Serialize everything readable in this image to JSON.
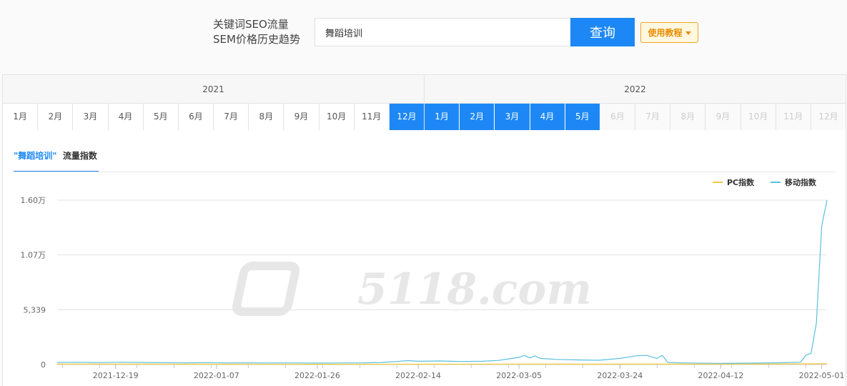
{
  "search": {
    "label_line1": "关键词SEO流量",
    "label_line2": "SEM价格历史趋势",
    "value": "舞蹈培训",
    "button_label": "查询",
    "tutorial_label": "使用教程"
  },
  "months": {
    "years": [
      {
        "label": "2021",
        "months": [
          {
            "label": "1月",
            "state": "normal"
          },
          {
            "label": "2月",
            "state": "normal"
          },
          {
            "label": "3月",
            "state": "normal"
          },
          {
            "label": "4月",
            "state": "normal"
          },
          {
            "label": "5月",
            "state": "normal"
          },
          {
            "label": "6月",
            "state": "normal"
          },
          {
            "label": "7月",
            "state": "normal"
          },
          {
            "label": "8月",
            "state": "normal"
          },
          {
            "label": "9月",
            "state": "normal"
          },
          {
            "label": "10月",
            "state": "normal"
          },
          {
            "label": "11月",
            "state": "normal"
          },
          {
            "label": "12月",
            "state": "selected"
          }
        ]
      },
      {
        "label": "2022",
        "months": [
          {
            "label": "1月",
            "state": "selected"
          },
          {
            "label": "2月",
            "state": "selected"
          },
          {
            "label": "3月",
            "state": "selected"
          },
          {
            "label": "4月",
            "state": "selected"
          },
          {
            "label": "5月",
            "state": "selected"
          },
          {
            "label": "6月",
            "state": "disabled"
          },
          {
            "label": "7月",
            "state": "disabled"
          },
          {
            "label": "8月",
            "state": "disabled"
          },
          {
            "label": "9月",
            "state": "disabled"
          },
          {
            "label": "10月",
            "state": "disabled"
          },
          {
            "label": "11月",
            "state": "disabled"
          },
          {
            "label": "12月",
            "state": "disabled"
          }
        ]
      }
    ]
  },
  "chart_tab": {
    "keyword": "\"舞蹈培训\"",
    "label": "流量指数"
  },
  "watermark": "5118.com",
  "colors": {
    "accent": "#1d88f5",
    "pc": "#f5c93d",
    "mobile": "#5bc0de"
  },
  "chart_data": {
    "type": "line",
    "x_start": "2021-12-08",
    "x_end": "2022-05-02",
    "xticks": [
      "2021-12-19",
      "2022-01-07",
      "2022-01-26",
      "2022-02-14",
      "2022-03-05",
      "2022-03-24",
      "2022-04-12",
      "2022-05-01"
    ],
    "ylim": [
      0,
      16017
    ],
    "yticks": [
      {
        "value": 0,
        "label": "0"
      },
      {
        "value": 5339,
        "label": "5,339"
      },
      {
        "value": 10678,
        "label": "1.07万"
      },
      {
        "value": 16017,
        "label": "1.60万"
      }
    ],
    "legend_position": "top-right",
    "series": [
      {
        "name": "PC指数",
        "points": [
          [
            "2021-12-08",
            40
          ],
          [
            "2021-12-20",
            40
          ],
          [
            "2022-01-07",
            35
          ],
          [
            "2022-01-26",
            30
          ],
          [
            "2022-02-14",
            35
          ],
          [
            "2022-03-05",
            45
          ],
          [
            "2022-03-24",
            40
          ],
          [
            "2022-04-12",
            45
          ],
          [
            "2022-04-25",
            60
          ],
          [
            "2022-04-29",
            70
          ],
          [
            "2022-05-02",
            90
          ]
        ]
      },
      {
        "name": "移动指数",
        "points": [
          [
            "2021-12-08",
            200
          ],
          [
            "2021-12-12",
            220
          ],
          [
            "2021-12-16",
            190
          ],
          [
            "2021-12-20",
            230
          ],
          [
            "2021-12-24",
            200
          ],
          [
            "2021-12-28",
            180
          ],
          [
            "2022-01-01",
            170
          ],
          [
            "2022-01-05",
            190
          ],
          [
            "2022-01-09",
            160
          ],
          [
            "2022-01-13",
            170
          ],
          [
            "2022-01-17",
            150
          ],
          [
            "2022-01-21",
            160
          ],
          [
            "2022-01-26",
            140
          ],
          [
            "2022-01-30",
            150
          ],
          [
            "2022-02-03",
            160
          ],
          [
            "2022-02-07",
            200
          ],
          [
            "2022-02-10",
            300
          ],
          [
            "2022-02-12",
            380
          ],
          [
            "2022-02-14",
            320
          ],
          [
            "2022-02-18",
            350
          ],
          [
            "2022-02-22",
            300
          ],
          [
            "2022-02-26",
            320
          ],
          [
            "2022-03-01",
            400
          ],
          [
            "2022-03-03",
            550
          ],
          [
            "2022-03-05",
            700
          ],
          [
            "2022-03-06",
            900
          ],
          [
            "2022-03-07",
            650
          ],
          [
            "2022-03-08",
            850
          ],
          [
            "2022-03-09",
            600
          ],
          [
            "2022-03-12",
            500
          ],
          [
            "2022-03-16",
            450
          ],
          [
            "2022-03-20",
            420
          ],
          [
            "2022-03-24",
            600
          ],
          [
            "2022-03-27",
            850
          ],
          [
            "2022-03-29",
            900
          ],
          [
            "2022-03-31",
            600
          ],
          [
            "2022-04-01",
            900
          ],
          [
            "2022-04-02",
            200
          ],
          [
            "2022-04-06",
            150
          ],
          [
            "2022-04-12",
            120
          ],
          [
            "2022-04-18",
            140
          ],
          [
            "2022-04-24",
            180
          ],
          [
            "2022-04-27",
            230
          ],
          [
            "2022-04-28",
            900
          ],
          [
            "2022-04-29",
            1100
          ],
          [
            "2022-04-30",
            4000
          ],
          [
            "2022-05-01",
            13500
          ],
          [
            "2022-05-02",
            16017
          ]
        ]
      }
    ]
  }
}
